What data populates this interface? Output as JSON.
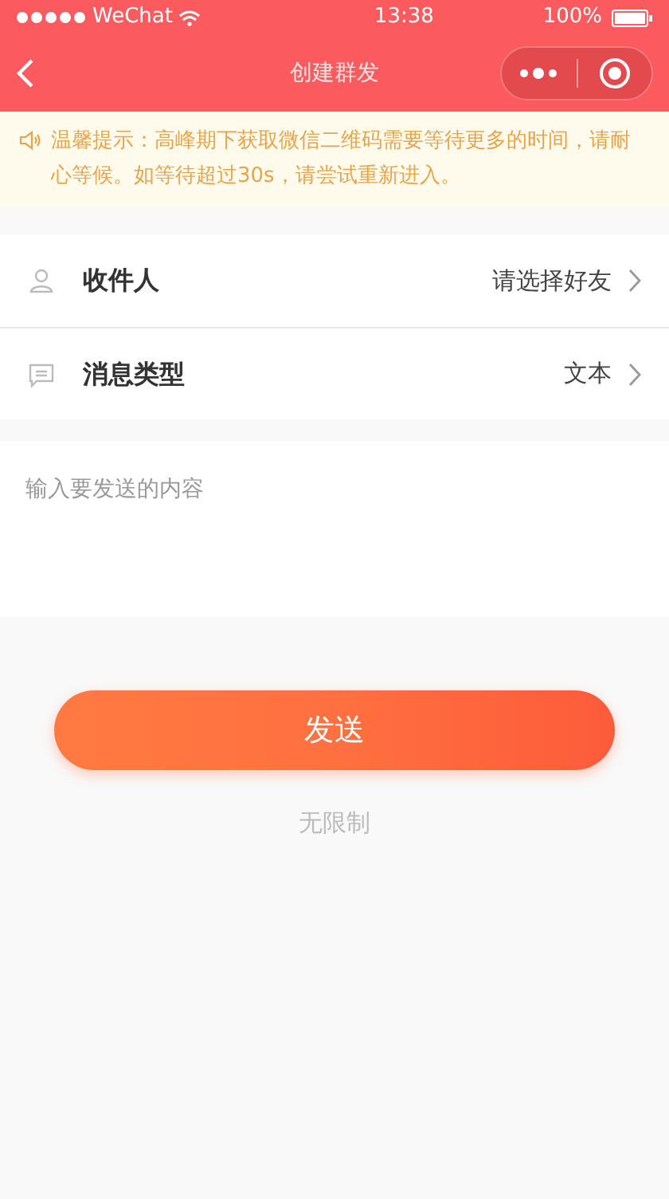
{
  "status_bar": {
    "carrier": "WeChat",
    "time": "13:38",
    "battery": "100%"
  },
  "nav": {
    "title": "创建群发"
  },
  "notice": {
    "text": "温馨提示：高峰期下获取微信二维码需要等待更多的时间，请耐心等候。如等待超过30s，请尝试重新进入。"
  },
  "rows": [
    {
      "kind": "person",
      "label": "收件人",
      "value": "请选择好友"
    },
    {
      "kind": "message",
      "label": "消息类型",
      "value": "文本"
    }
  ],
  "message": {
    "placeholder": "输入要发送的内容"
  },
  "send_button": "发送",
  "limit_text": "无限制"
}
